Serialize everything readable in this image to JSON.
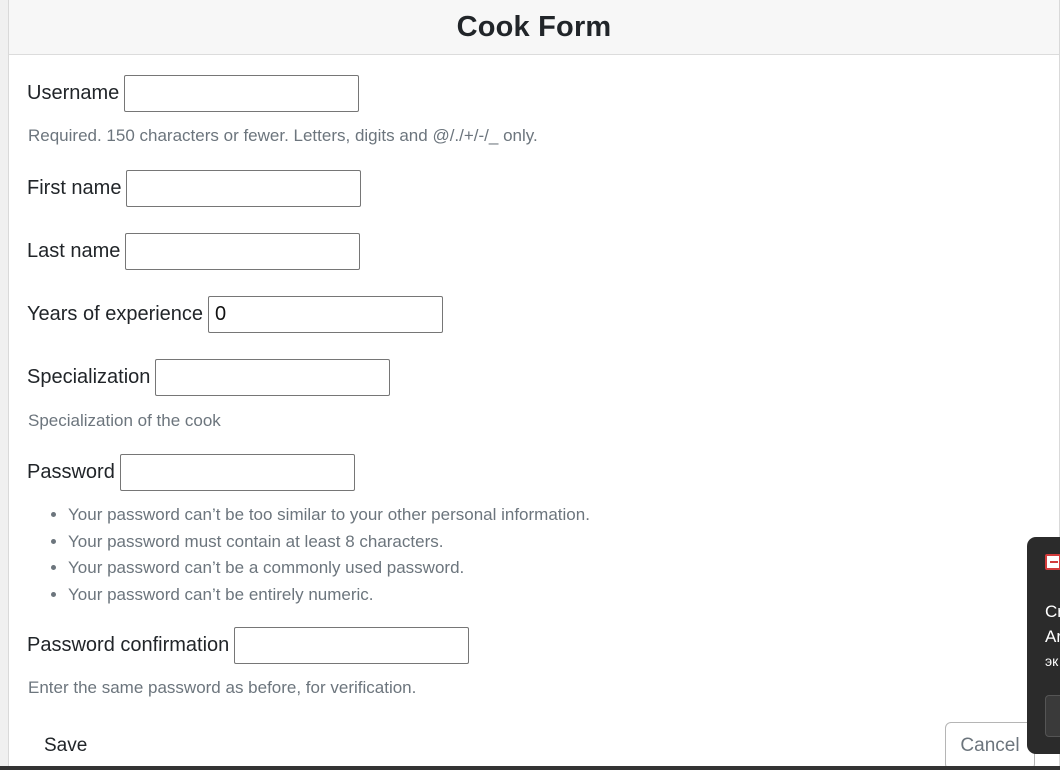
{
  "form": {
    "title": "Cook Form",
    "fields": {
      "username": {
        "label": "Username",
        "value": "",
        "help": "Required. 150 characters or fewer. Letters, digits and @/./+/-/_ only."
      },
      "first_name": {
        "label": "First name",
        "value": ""
      },
      "last_name": {
        "label": "Last name",
        "value": ""
      },
      "years_of_experience": {
        "label": "Years of experience",
        "value": "0"
      },
      "specialization": {
        "label": "Specialization",
        "value": "",
        "help": "Specialization of the cook"
      },
      "password": {
        "label": "Password",
        "value": "",
        "help_items": [
          "Your password can’t be too similar to your other personal information.",
          "Your password must contain at least 8 characters.",
          "Your password can’t be a commonly used password.",
          "Your password can’t be entirely numeric."
        ]
      },
      "password_confirmation": {
        "label": "Password confirmation",
        "value": "",
        "help": "Enter the same password as before, for verification."
      }
    },
    "buttons": {
      "save_label": "Save",
      "cancel_label": "Cancel"
    }
  },
  "notification": {
    "icon": "app-icon",
    "lines": [
      "Cr",
      "Ar",
      "эк"
    ]
  }
}
